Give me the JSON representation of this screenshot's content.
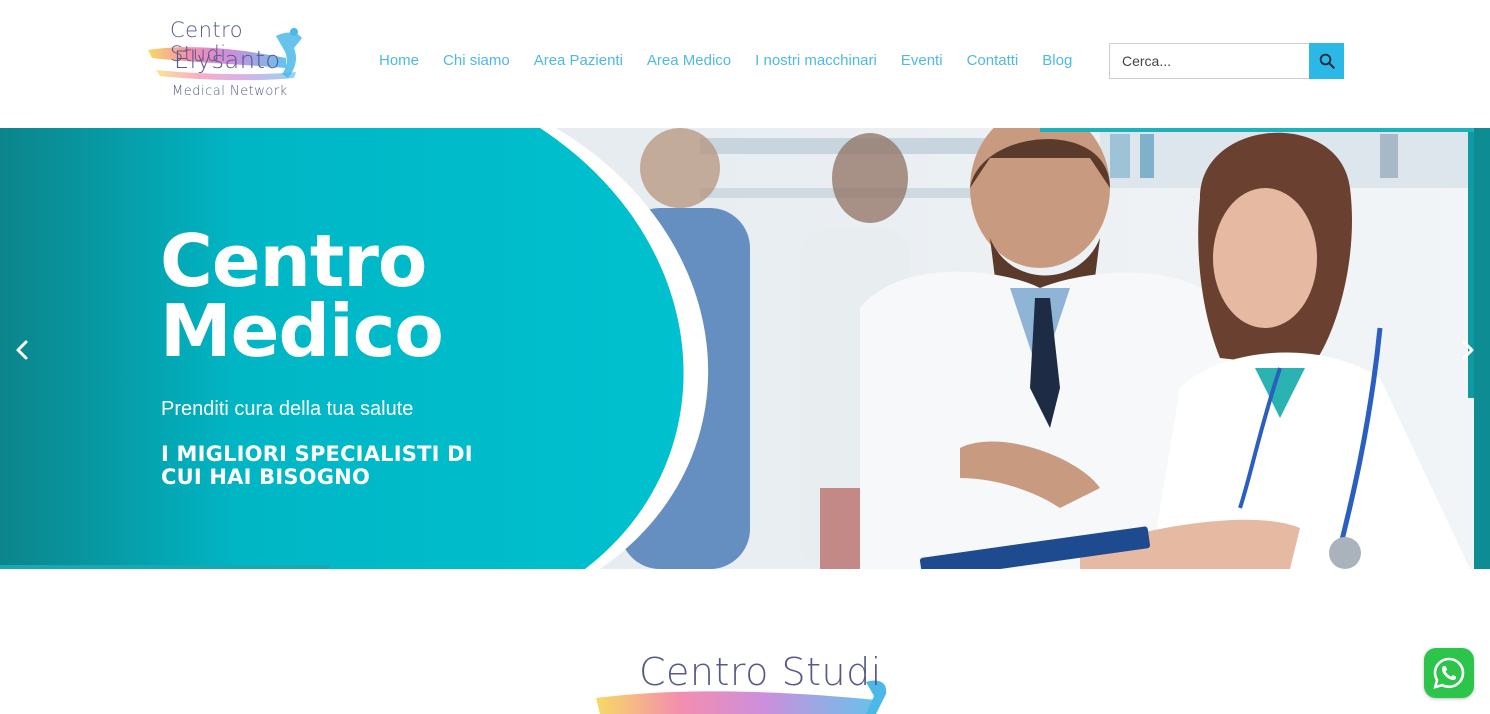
{
  "brand": {
    "line1": "Centro Studi",
    "line2": "Elysanto",
    "line3": "Medical Network"
  },
  "nav": {
    "items": [
      {
        "label": "Home"
      },
      {
        "label": "Chi siamo"
      },
      {
        "label": "Area Pazienti"
      },
      {
        "label": "Area Medico"
      },
      {
        "label": "I nostri macchinari"
      },
      {
        "label": "Eventi"
      },
      {
        "label": "Contatti"
      },
      {
        "label": "Blog"
      }
    ]
  },
  "search": {
    "placeholder": "Cerca...",
    "icon": "search-icon"
  },
  "hero": {
    "title_line1": "Centro",
    "title_line2": "Medico",
    "subtitle": "Prenditi cura della tua salute",
    "cta_line1": "I MIGLIORI SPECIALISTI DI",
    "cta_line2": "CUI HAI BISOGNO",
    "prev_icon": "chevron-left-icon",
    "next_icon": "chevron-right-icon"
  },
  "section_logo": {
    "line1": "Centro Studi"
  },
  "colors": {
    "nav_link": "#4fb9e0",
    "accent": "#2cb8e6",
    "teal": "#00bccb",
    "dark_teal": "#0d8c93",
    "whatsapp": "#2dc44b"
  },
  "floating": {
    "icon": "whatsapp-icon"
  }
}
